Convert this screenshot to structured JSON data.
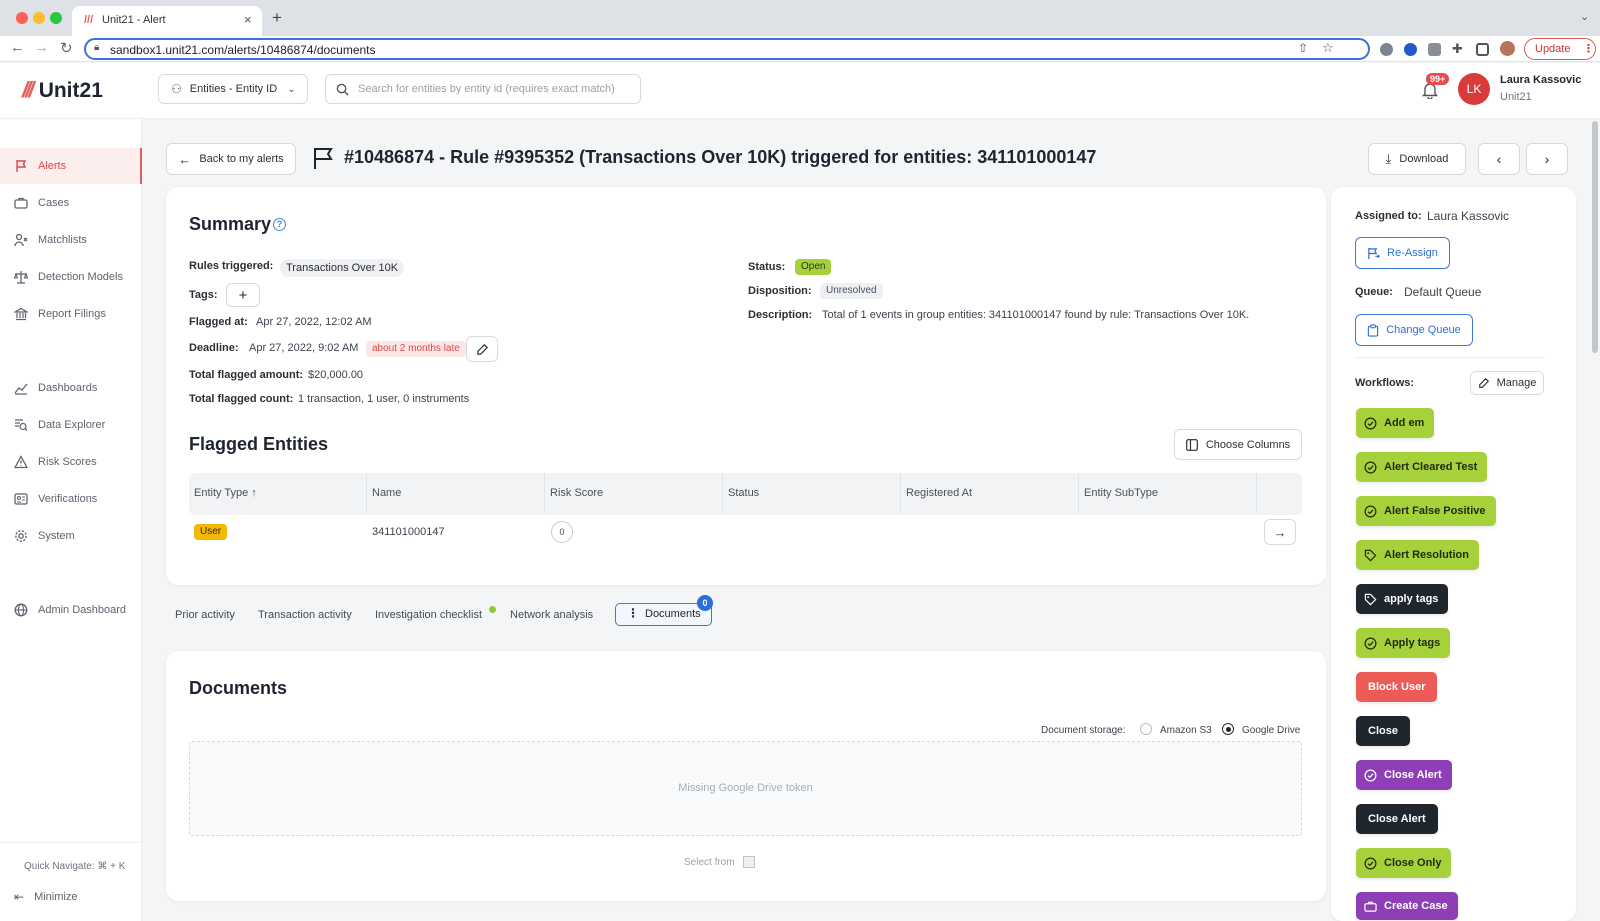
{
  "browser": {
    "tab_title": "Unit21 - Alert",
    "url": "sandbox1.unit21.com/alerts/10486874/documents",
    "update_label": "Update"
  },
  "header": {
    "logo_text": "Unit21",
    "entity_dropdown": "Entities - Entity ID",
    "search_placeholder": "Search for entities by entity id (requires exact match)",
    "notification_badge": "99+",
    "user_initials": "LK",
    "user_name": "Laura Kassovic",
    "user_org": "Unit21"
  },
  "sidebar": {
    "items": [
      {
        "label": "Alerts",
        "icon": "flag-icon"
      },
      {
        "label": "Cases",
        "icon": "briefcase-icon"
      },
      {
        "label": "Matchlists",
        "icon": "user-x-icon"
      },
      {
        "label": "Detection Models",
        "icon": "scale-icon"
      },
      {
        "label": "Report Filings",
        "icon": "bank-icon"
      },
      {
        "label": "Dashboards",
        "icon": "chart-icon"
      },
      {
        "label": "Data Explorer",
        "icon": "search-doc-icon"
      },
      {
        "label": "Risk Scores",
        "icon": "warning-icon"
      },
      {
        "label": "Verifications",
        "icon": "id-card-icon"
      },
      {
        "label": "System",
        "icon": "gear-icon"
      },
      {
        "label": "Admin Dashboard",
        "icon": "globe-icon"
      }
    ],
    "quick_navigate": "Quick Navigate: ⌘ + K",
    "minimize": "Minimize"
  },
  "page": {
    "back_label": "Back to my alerts",
    "title": "#10486874 - Rule #9395352 (Transactions Over 10K) triggered for entities: 341101000147",
    "download_label": "Download"
  },
  "summary": {
    "heading": "Summary",
    "rules_triggered_label": "Rules triggered:",
    "rules_triggered_value": "Transactions Over 10K",
    "tags_label": "Tags:",
    "flagged_at_label": "Flagged at:",
    "flagged_at_value": "Apr 27, 2022, 12:02 AM",
    "deadline_label": "Deadline:",
    "deadline_value": "Apr 27, 2022, 9:02 AM",
    "deadline_badge": "about 2 months late",
    "total_amount_label": "Total flagged amount:",
    "total_amount_value": "$20,000.00",
    "total_count_label": "Total flagged count:",
    "total_count_value": "1 transaction, 1 user, 0 instruments",
    "status_label": "Status:",
    "status_value": "Open",
    "disposition_label": "Disposition:",
    "disposition_value": "Unresolved",
    "description_label": "Description:",
    "description_value": "Total of 1 events in group entities: 341101000147 found by rule: Transactions Over 10K."
  },
  "flagged_entities": {
    "heading": "Flagged Entities",
    "choose_columns": "Choose Columns",
    "columns": [
      "Entity Type",
      "Name",
      "Risk Score",
      "Status",
      "Registered At",
      "Entity SubType"
    ],
    "rows": [
      {
        "entity_type": "User",
        "name": "341101000147",
        "risk_score": "0",
        "status": "",
        "registered_at": "",
        "subtype": ""
      }
    ]
  },
  "tabs": {
    "items": [
      "Prior activity",
      "Transaction activity",
      "Investigation checklist",
      "Network analysis"
    ],
    "active": "Documents",
    "active_badge": "0"
  },
  "documents": {
    "heading": "Documents",
    "storage_label": "Document storage:",
    "options": [
      "Amazon S3",
      "Google Drive"
    ],
    "selected": "Google Drive",
    "empty_message": "Missing Google Drive token",
    "select_from": "Select from"
  },
  "right_panel": {
    "assigned_label": "Assigned to:",
    "assigned_value": "Laura Kassovic",
    "reassign": "Re-Assign",
    "queue_label": "Queue:",
    "queue_value": "Default Queue",
    "change_queue": "Change Queue",
    "workflows_label": "Workflows:",
    "manage": "Manage",
    "workflows": [
      {
        "label": "Add em",
        "style": "lime",
        "icon": "check-circle-icon"
      },
      {
        "label": "Alert Cleared Test",
        "style": "lime",
        "icon": "check-circle-icon"
      },
      {
        "label": "Alert False Positive",
        "style": "lime",
        "icon": "check-circle-icon"
      },
      {
        "label": "Alert Resolution",
        "style": "lime",
        "icon": "tag-icon"
      },
      {
        "label": "apply tags",
        "style": "dark",
        "icon": "tag-icon"
      },
      {
        "label": "Apply tags",
        "style": "lime",
        "icon": "check-circle-icon"
      },
      {
        "label": "Block User",
        "style": "red",
        "icon": ""
      },
      {
        "label": "Close",
        "style": "dark",
        "icon": ""
      },
      {
        "label": "Close Alert",
        "style": "purple",
        "icon": "check-circle-icon"
      },
      {
        "label": "Close Alert",
        "style": "dark",
        "icon": ""
      },
      {
        "label": "Close Only",
        "style": "lime",
        "icon": "check-circle-icon"
      },
      {
        "label": "Create Case",
        "style": "purple",
        "icon": "briefcase-icon"
      }
    ]
  },
  "colors": {
    "accent_red": "#e35d5d",
    "lime": "#a6d13a",
    "blue": "#2a6fdb",
    "purple": "#8f3fb5"
  }
}
